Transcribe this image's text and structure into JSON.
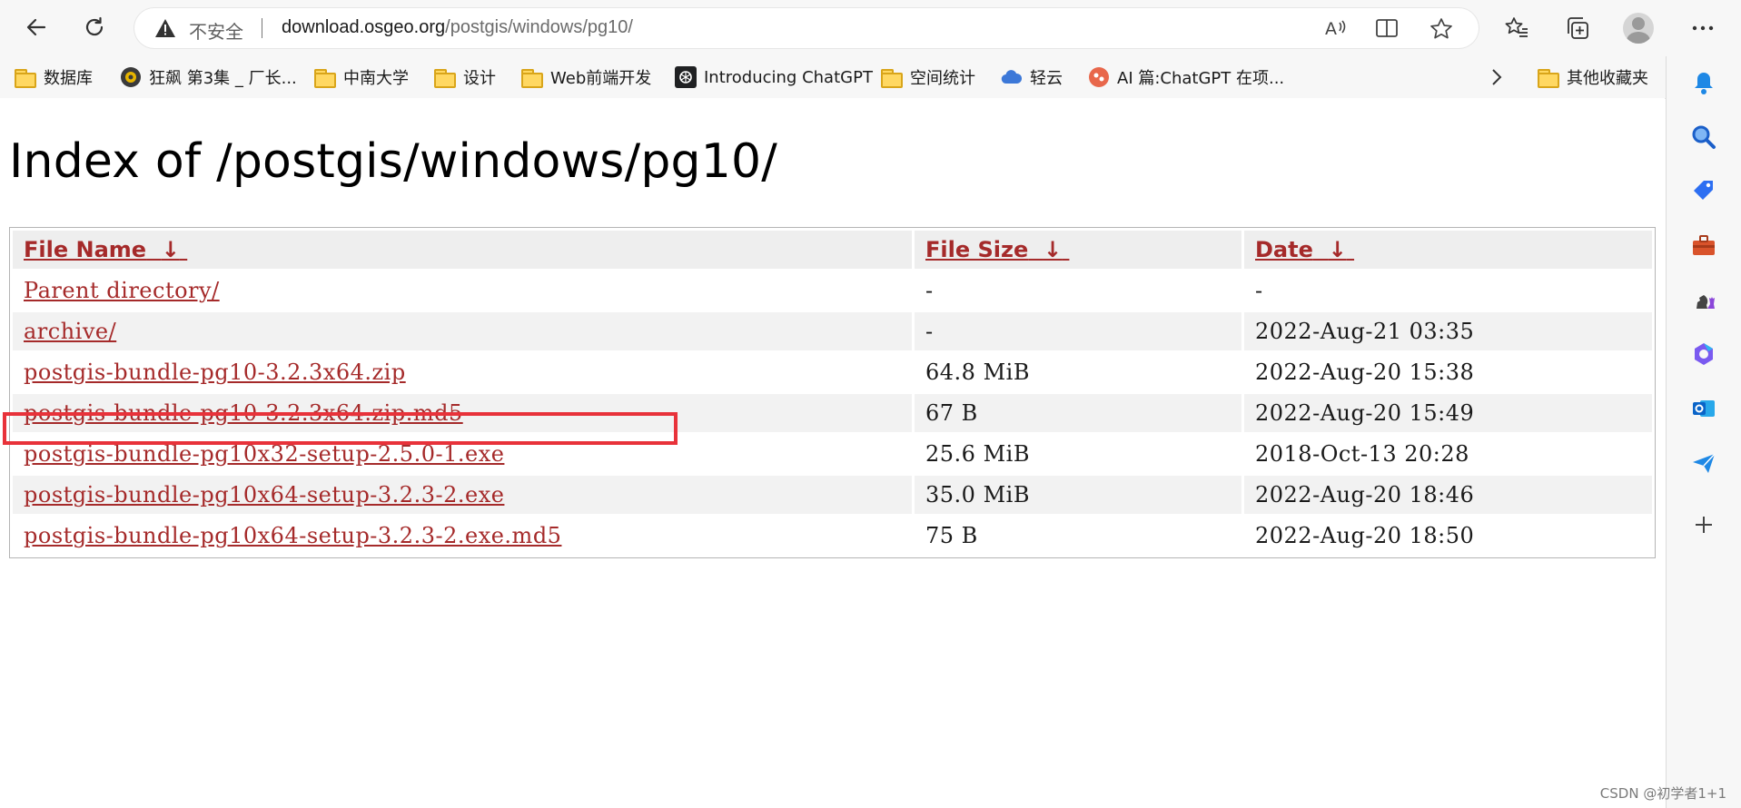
{
  "browser": {
    "security_text": "不安全",
    "url_host": "download.osgeo.org",
    "url_path": "/postgis/windows/pg10/"
  },
  "bookmarks": [
    {
      "label": "数据库",
      "icon": "folder-icon"
    },
    {
      "label": "狂飙 第3集 _ 厂长...",
      "icon": "site-icon"
    },
    {
      "label": "中南大学",
      "icon": "folder-icon"
    },
    {
      "label": "设计",
      "icon": "folder-icon"
    },
    {
      "label": "Web前端开发",
      "icon": "folder-icon"
    },
    {
      "label": "Introducing ChatGPT",
      "icon": "chatgpt-icon"
    },
    {
      "label": "空间统计",
      "icon": "folder-icon"
    },
    {
      "label": "轻云",
      "icon": "cloud-icon"
    },
    {
      "label": "AI 篇:ChatGPT 在项...",
      "icon": "site-icon"
    }
  ],
  "other_bookmarks": "其他收藏夹",
  "page": {
    "title": "Index of /postgis/windows/pg10/",
    "headers": {
      "name": "File Name",
      "size": "File Size",
      "date": "Date",
      "sort_arrow": "↓"
    },
    "rows": [
      {
        "name": "Parent directory/",
        "size": "-",
        "date": "-"
      },
      {
        "name": "archive/",
        "size": "-",
        "date": "2022-Aug-21 03:35"
      },
      {
        "name": "postgis-bundle-pg10-3.2.3x64.zip",
        "size": "64.8 MiB",
        "date": "2022-Aug-20 15:38"
      },
      {
        "name": "postgis-bundle-pg10-3.2.3x64.zip.md5",
        "size": "67 B",
        "date": "2022-Aug-20 15:49"
      },
      {
        "name": "postgis-bundle-pg10x32-setup-2.5.0-1.exe",
        "size": "25.6 MiB",
        "date": "2018-Oct-13 20:28"
      },
      {
        "name": "postgis-bundle-pg10x64-setup-3.2.3-2.exe",
        "size": "35.0 MiB",
        "date": "2022-Aug-20 18:46"
      },
      {
        "name": "postgis-bundle-pg10x64-setup-3.2.3-2.exe.md5",
        "size": "75 B",
        "date": "2022-Aug-20 18:50"
      }
    ]
  },
  "watermark": "CSDN @初学者1+1",
  "colors": {
    "link": "#a52a2a",
    "highlight": "#e8323a"
  }
}
